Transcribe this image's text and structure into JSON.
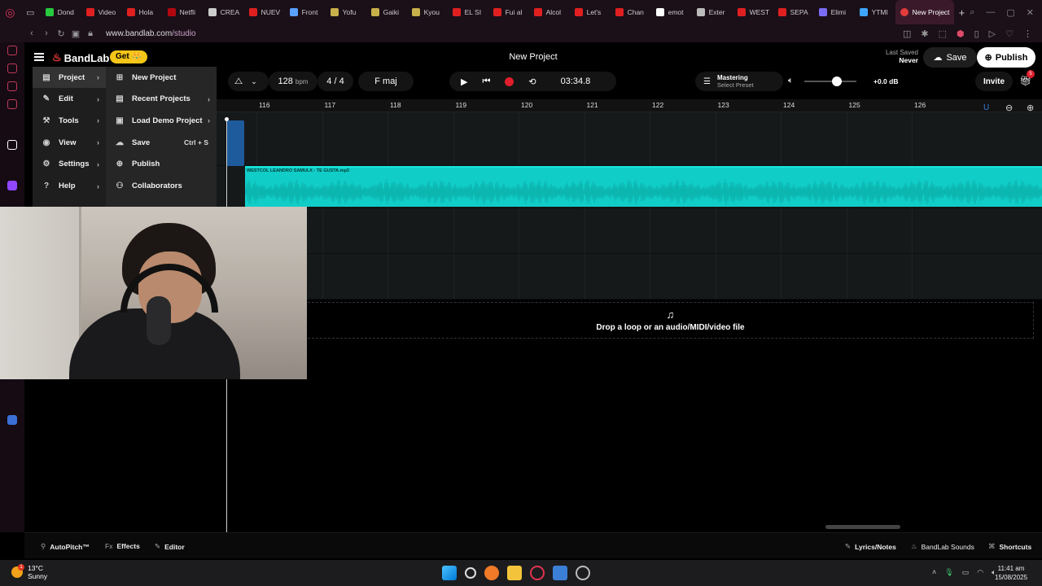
{
  "browser": {
    "tabs": [
      {
        "title": "Dond",
        "color": "#27c93f"
      },
      {
        "title": "Video",
        "color": "#e02020"
      },
      {
        "title": "Hola",
        "color": "#e02020"
      },
      {
        "title": "Netfli",
        "color": "#b20710"
      },
      {
        "title": "CREA",
        "color": "#cccccc"
      },
      {
        "title": "NUEV",
        "color": "#e02020"
      },
      {
        "title": "Front",
        "color": "#5aa0ff"
      },
      {
        "title": "Yofu",
        "color": "#c8b04a"
      },
      {
        "title": "Gaiki",
        "color": "#c8b04a"
      },
      {
        "title": "Kyou",
        "color": "#c8b04a"
      },
      {
        "title": "EL SI",
        "color": "#e02020"
      },
      {
        "title": "Fui al",
        "color": "#e02020"
      },
      {
        "title": "Alcol",
        "color": "#e02020"
      },
      {
        "title": "Let's",
        "color": "#e02020"
      },
      {
        "title": "Chan",
        "color": "#e02020"
      },
      {
        "title": "emot",
        "color": "#ffffff"
      },
      {
        "title": "Exter",
        "color": "#bbbbbb"
      },
      {
        "title": "WEST",
        "color": "#e02020"
      },
      {
        "title": "SEPA",
        "color": "#e02020"
      },
      {
        "title": "Elimi",
        "color": "#7b6cf6"
      },
      {
        "title": "YTMI",
        "color": "#3ea6ff"
      }
    ],
    "active_tab": "New Project",
    "url_host": "www.bandlab.com",
    "url_path": "/studio"
  },
  "app": {
    "logo": "BandLab",
    "get_label": "Get 👑",
    "project_title": "New Project",
    "last_saved_label": "Last Saved",
    "last_saved_value": "Never",
    "save_label": "Save",
    "publish_label": "Publish"
  },
  "transport": {
    "bpm": "128",
    "bpm_unit": "bpm",
    "time_sig": "4 / 4",
    "key": "F maj",
    "time": "03:34.8",
    "mastering_label": "Mastering",
    "mastering_sub": "Select Preset",
    "volume_db": "+0.0 dB",
    "volume_level": 0.62,
    "invite_label": "Invite",
    "notif_count": "5"
  },
  "menu": {
    "main": [
      "Project",
      "Edit",
      "Tools",
      "View",
      "Settings",
      "Help"
    ],
    "main_icons": [
      "page-icon",
      "pencil-icon",
      "wrench-icon",
      "eye-icon",
      "gear-icon",
      "help-icon"
    ],
    "project_sub": [
      {
        "label": "New Project",
        "shortcut": "",
        "submenu": false
      },
      {
        "label": "Recent Projects",
        "shortcut": "",
        "submenu": true
      },
      {
        "label": "Load Demo Project",
        "shortcut": "",
        "submenu": true
      },
      {
        "label": "Save",
        "shortcut": "Ctrl + S",
        "submenu": false
      },
      {
        "label": "Publish",
        "shortcut": "",
        "submenu": false
      },
      {
        "label": "Collaborators",
        "shortcut": "",
        "submenu": false
      }
    ]
  },
  "timeline": {
    "bars": [
      "116",
      "117",
      "118",
      "119",
      "120",
      "121",
      "122",
      "123",
      "124",
      "125",
      "126"
    ],
    "clip_name": "WESTCOL LEANDRO SAMULX - TE GUSTA.mp3",
    "drop_text": "Drop a loop or an audio/MIDI/video file"
  },
  "bottom": {
    "autopitch": "AutoPitch™",
    "effects": "Effects",
    "editor": "Editor",
    "lyrics": "Lyrics/Notes",
    "sounds": "BandLab Sounds",
    "shortcuts": "Shortcuts"
  },
  "taskbar": {
    "temp": "13°C",
    "weather": "Sunny",
    "time": "11:41 am",
    "date": "15/08/2025"
  }
}
